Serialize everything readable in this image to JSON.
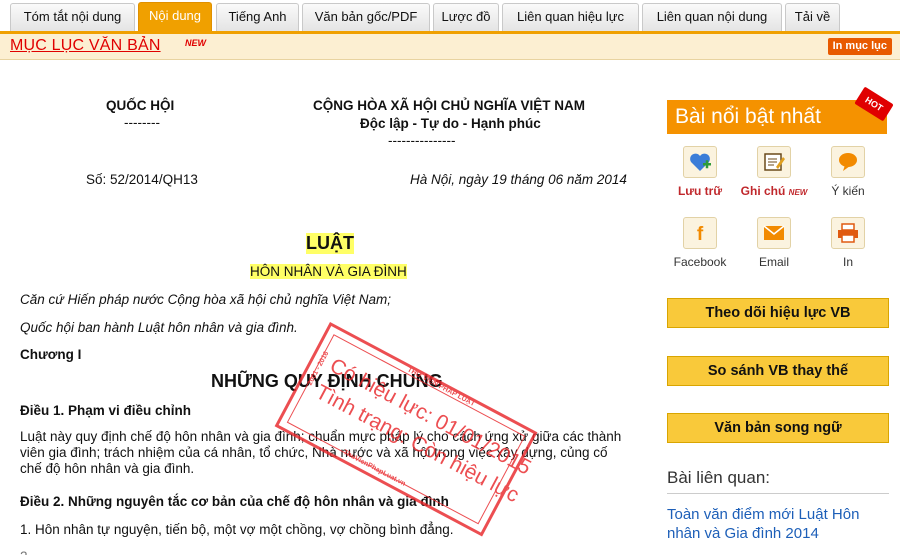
{
  "tabs": [
    {
      "label": "Tóm tắt nội dung",
      "active": false
    },
    {
      "label": "Nội dung",
      "active": true
    },
    {
      "label": "Tiếng Anh",
      "active": false
    },
    {
      "label": "Văn bản gốc/PDF",
      "active": false
    },
    {
      "label": "Lược đồ",
      "active": false
    },
    {
      "label": "Liên quan hiệu lực",
      "active": false
    },
    {
      "label": "Liên quan nội dung",
      "active": false
    },
    {
      "label": "Tải về",
      "active": false
    }
  ],
  "toc": {
    "title": "MỤC LỤC VĂN BẢN",
    "new_badge": "NEW",
    "print_label": "In mục lục"
  },
  "header": {
    "issuer": "QUỐC HỘI",
    "issuer_sep": "--------",
    "nation": "CỘNG HÒA XÃ HỘI CHỦ NGHĨA VIỆT NAM",
    "motto": "Độc lập - Tự do - Hạnh phúc",
    "motto_sep": "---------------",
    "number": "Số: 52/2014/QH13",
    "place_date": "Hà Nội, ngày 19 tháng 06 năm 2014"
  },
  "law": {
    "title": "LUẬT",
    "subtitle": "HÔN NHÂN VÀ GIA ĐÌNH",
    "basis": "Căn cứ Hiến pháp nước Cộng hòa xã hội chủ nghĩa Việt Nam;",
    "enact": "Quốc hội ban hành Luật hôn nhân và gia đình.",
    "chapter": "Chương I",
    "chapter_title": "NHỮNG QUY ĐỊNH CHUNG",
    "art1_title": "Điều 1. Phạm vi điều chỉnh",
    "art1_body": "Luật này quy định chế độ hôn nhân và gia đình; chuẩn mực pháp lý cho cách ứng xử giữa các thành viên gia đình; trách nhiệm của cá nhân, tổ chức, Nhà nước và xã hội trong việc xây dựng, củng cố chế độ hôn nhân và gia đình.",
    "art2_title": "Điều 2. Những nguyên tắc cơ bản của chế độ hôn nhân và gia đình",
    "art2_p1": "1. Hôn nhân tự nguyện, tiến bộ, một vợ một chồng, vợ chồng bình đẳng."
  },
  "stamp": {
    "line1": "Có hiệu lực: 01/01/2015",
    "line2": "Tình trạng: Còn hiệu lực",
    "top_text": "THƯ VIỆN PHÁP LUẬT",
    "side_text": "2001 - 2016",
    "bottom_text": "ThuVienPhapLuat.vn"
  },
  "sidebar": {
    "hot_title": "Bài nổi bật nhất",
    "hot_tag": "HOT",
    "actions": [
      {
        "label": "Lưu trữ",
        "icon": "heart-plus-icon"
      },
      {
        "label": "Ghi chú",
        "icon": "note-icon"
      },
      {
        "label": "Ý kiến",
        "icon": "comment-icon"
      },
      {
        "label": "Facebook",
        "icon": "facebook-icon"
      },
      {
        "label": "Email",
        "icon": "email-icon"
      },
      {
        "label": "In",
        "icon": "printer-icon"
      }
    ],
    "note_new": "NEW",
    "btn_track": "Theo dõi hiệu lực VB",
    "btn_compare": "So sánh VB thay thế",
    "btn_bilingual": "Văn bản song ngữ",
    "related_title": "Bài liên quan:",
    "related_link": "Toàn văn điểm mới Luật Hôn nhân và Gia đình 2014"
  },
  "colors": {
    "accent": "#f0a000",
    "hot": "#f59200",
    "link": "#1d5fb8",
    "stamp": "#e8282c",
    "button": "#f9c93a"
  }
}
